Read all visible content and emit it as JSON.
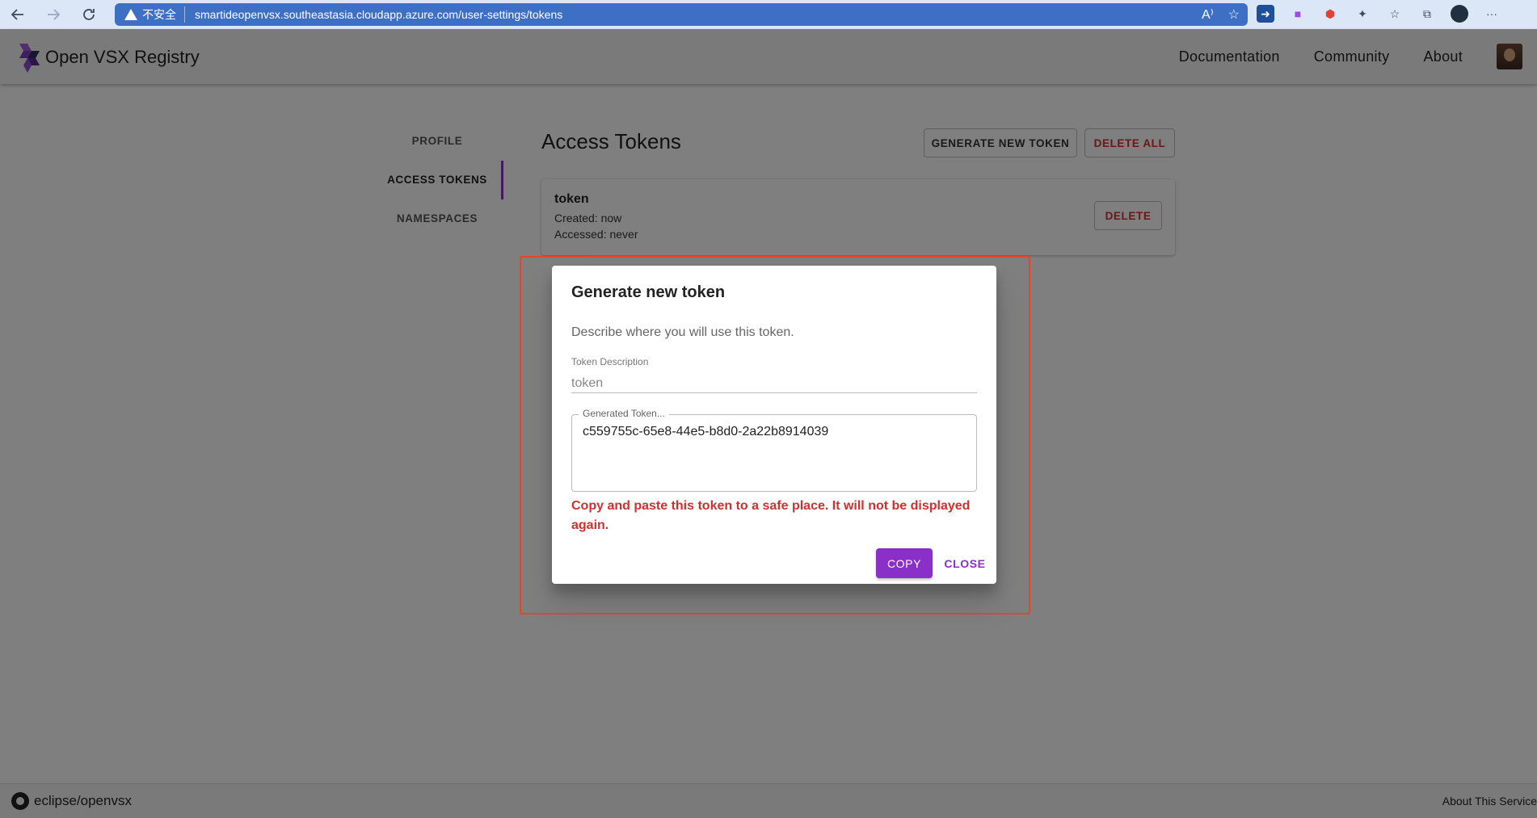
{
  "browser": {
    "security_label": "不安全",
    "url": "smartideopenvsx.southeastasia.cloudapp.azure.com/user-settings/tokens",
    "icons": [
      "back-icon",
      "forward-icon",
      "reload-icon",
      "warning-icon",
      "read-aloud-icon",
      "add-favorite-icon",
      "extension-icons",
      "favorites-icon",
      "collections-icon",
      "profile-icon",
      "more-icon"
    ]
  },
  "header": {
    "logo_text": "Open VSX Registry",
    "nav": [
      "Documentation",
      "Community",
      "About"
    ]
  },
  "sidebar": {
    "items": [
      {
        "label": "PROFILE",
        "active": false
      },
      {
        "label": "ACCESS TOKENS",
        "active": true
      },
      {
        "label": "NAMESPACES",
        "active": false
      }
    ]
  },
  "main": {
    "title": "Access Tokens",
    "generate_label": "GENERATE NEW TOKEN",
    "delete_all_label": "DELETE ALL",
    "token": {
      "name": "token",
      "created": "Created: now",
      "accessed": "Accessed: never",
      "delete_label": "DELETE"
    }
  },
  "dialog": {
    "title": "Generate new token",
    "description": "Describe where you will use this token.",
    "field_label": "Token Description",
    "field_value": "token",
    "generated_label": "Generated Token...",
    "generated_value": "c559755c-65e8-44e5-b8d0-2a22b8914039",
    "warning": "Copy and paste this token to a safe place. It will not be displayed again.",
    "copy_label": "COPY",
    "close_label": "CLOSE"
  },
  "footer": {
    "repo": "eclipse/openvsx",
    "about": "About This Service"
  },
  "colors": {
    "accent": "#8b2fc9",
    "danger": "#d32f2f",
    "browser_url_bg": "#3d6fc4",
    "highlight_box": "#e8432f"
  }
}
